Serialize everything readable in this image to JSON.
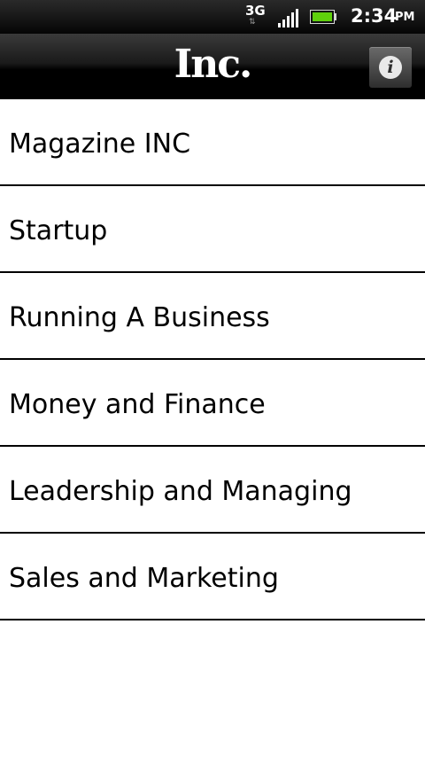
{
  "status_bar": {
    "network_type": "3G",
    "network_activity_icon": "up-down-arrows-icon",
    "signal_icon": "signal-strength-icon",
    "battery_icon": "battery-icon",
    "time": "2:34",
    "ampm": "PM"
  },
  "header": {
    "logo_text": "Inc.",
    "info_button_glyph": "i",
    "info_icon": "info-icon"
  },
  "menu": {
    "items": [
      {
        "label": "Magazine INC"
      },
      {
        "label": "Startup"
      },
      {
        "label": "Running A Business"
      },
      {
        "label": "Money and Finance"
      },
      {
        "label": "Leadership and Managing"
      },
      {
        "label": "Sales and Marketing"
      }
    ]
  },
  "colors": {
    "header_background": "#000000",
    "list_background": "#ffffff",
    "divider": "#000000",
    "text": "#000000",
    "battery_fill": "#5fd10c"
  }
}
